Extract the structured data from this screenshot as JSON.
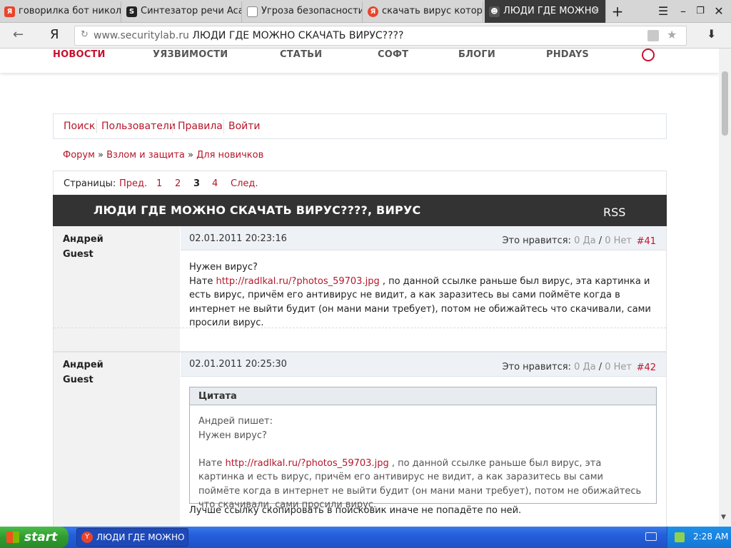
{
  "browser": {
    "tabs": [
      {
        "title": "говорилка бот никола",
        "favicon": "yandex-icon",
        "color": "#e8452c"
      },
      {
        "title": "Синтезатор речи Acap",
        "favicon": "acapela-icon",
        "color": "#222222"
      },
      {
        "title": "Угроза безопасности",
        "favicon": "page-icon",
        "color": "#888888"
      },
      {
        "title": "скачать вирус которы",
        "favicon": "yandex-icon",
        "color": "#e8452c"
      },
      {
        "title": "ЛЮДИ ГДЕ МОЖНО",
        "favicon": "securitylab-icon",
        "color": "#333333"
      }
    ],
    "url_domain": "www.securitylab.ru",
    "url_title": "ЛЮДИ ГДЕ МОЖНО СКАЧАТЬ ВИРУС????",
    "logo": "Я"
  },
  "site_nav": [
    "НОВОСТИ",
    "УЯЗВИМОСТИ",
    "СТАТЬИ",
    "СОФТ",
    "БЛОГИ",
    "PHDAYS"
  ],
  "forum_links": [
    "Поиск",
    "Пользователи",
    "Правила",
    "Войти"
  ],
  "breadcrumb": [
    "Форум",
    "Взлом и защита",
    "Для новичков"
  ],
  "pages": {
    "label": "Страницы:",
    "prev": "Пред.",
    "items": [
      "1",
      "2",
      "3",
      "4"
    ],
    "current": "3",
    "next": "След."
  },
  "thread": {
    "title": "ЛЮДИ ГДЕ МОЖНО СКАЧАТЬ ВИРУС????, ВИРУС",
    "rss": "RSS"
  },
  "likes_label": "Это нравится:",
  "posts": [
    {
      "author": "Андрей",
      "role": "Guest",
      "date": "02.01.2011 20:23:16",
      "yes": "0 Да",
      "no": "0 Нет",
      "num": "#41",
      "line1": "Нужен вирус?",
      "pre": "Нате ",
      "link": "http://radlkal.ru/?photos_59703.jpg",
      "rest": " , по данной ссылке раньше был вирус, эта картинка и есть вирус, причём его антивирус не видит, а как заразитесь вы сами поймёте когда в интернет не выйти будит (он мани мани требует), потом не обижайтесь что скачивали, сами просили вирус."
    },
    {
      "author": "Андрей",
      "role": "Guest",
      "date": "02.01.2011 20:25:30",
      "yes": "0 Да",
      "no": "0 Нет",
      "num": "#42",
      "quote_title": "Цитата",
      "quote_author": "Андрей пишет:",
      "quote_line1": "Нужен вирус?",
      "quote_pre": "Нате ",
      "quote_link": "http://radlkal.ru/?photos_59703.jpg",
      "quote_rest": " , по данной ссылке раньше был вирус, эта картинка и есть вирус, причём его антивирус не видит, а как заразитесь вы сами поймёте когда в интернет не выйти будит (он мани мани требует), потом не обижайтесь что скачивали, сами просили вирус.",
      "after": "Лучше ссылку скопировать в поисковик иначе не попадёте по ней."
    }
  ],
  "taskbar": {
    "start": "start",
    "item": "ЛЮДИ ГДЕ МОЖНО ...",
    "clock": "2:28 AM"
  }
}
